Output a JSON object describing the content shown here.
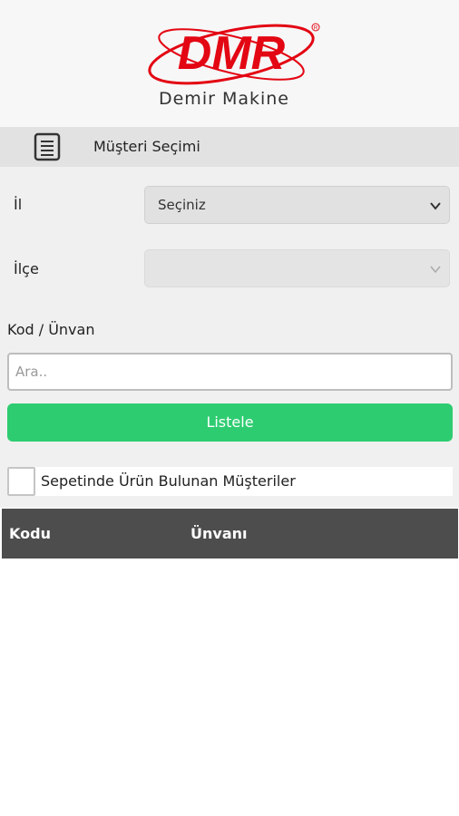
{
  "brand": {
    "name": "DMR",
    "tagline": "Demir Makine",
    "accent_color": "#e30613"
  },
  "header": {
    "icon": "list-document-icon",
    "title": "Müşteri Seçimi"
  },
  "form": {
    "il_label": "İl",
    "il_select_value": "Seçiniz",
    "ilce_label": "İlçe",
    "ilce_select_value": "",
    "kod_label": "Kod / Ünvan",
    "search_placeholder": "Ara..",
    "search_value": "",
    "list_button_label": "Listele",
    "checkbox_label": "Sepetinde Ürün Bulunan Müşteriler",
    "checkbox_checked": false
  },
  "table": {
    "columns": [
      "Kodu",
      "Ünvanı"
    ],
    "rows": []
  },
  "colors": {
    "button_green": "#2ecc71",
    "table_header": "#4d4d4d",
    "header_bar": "#e2e2e2"
  }
}
